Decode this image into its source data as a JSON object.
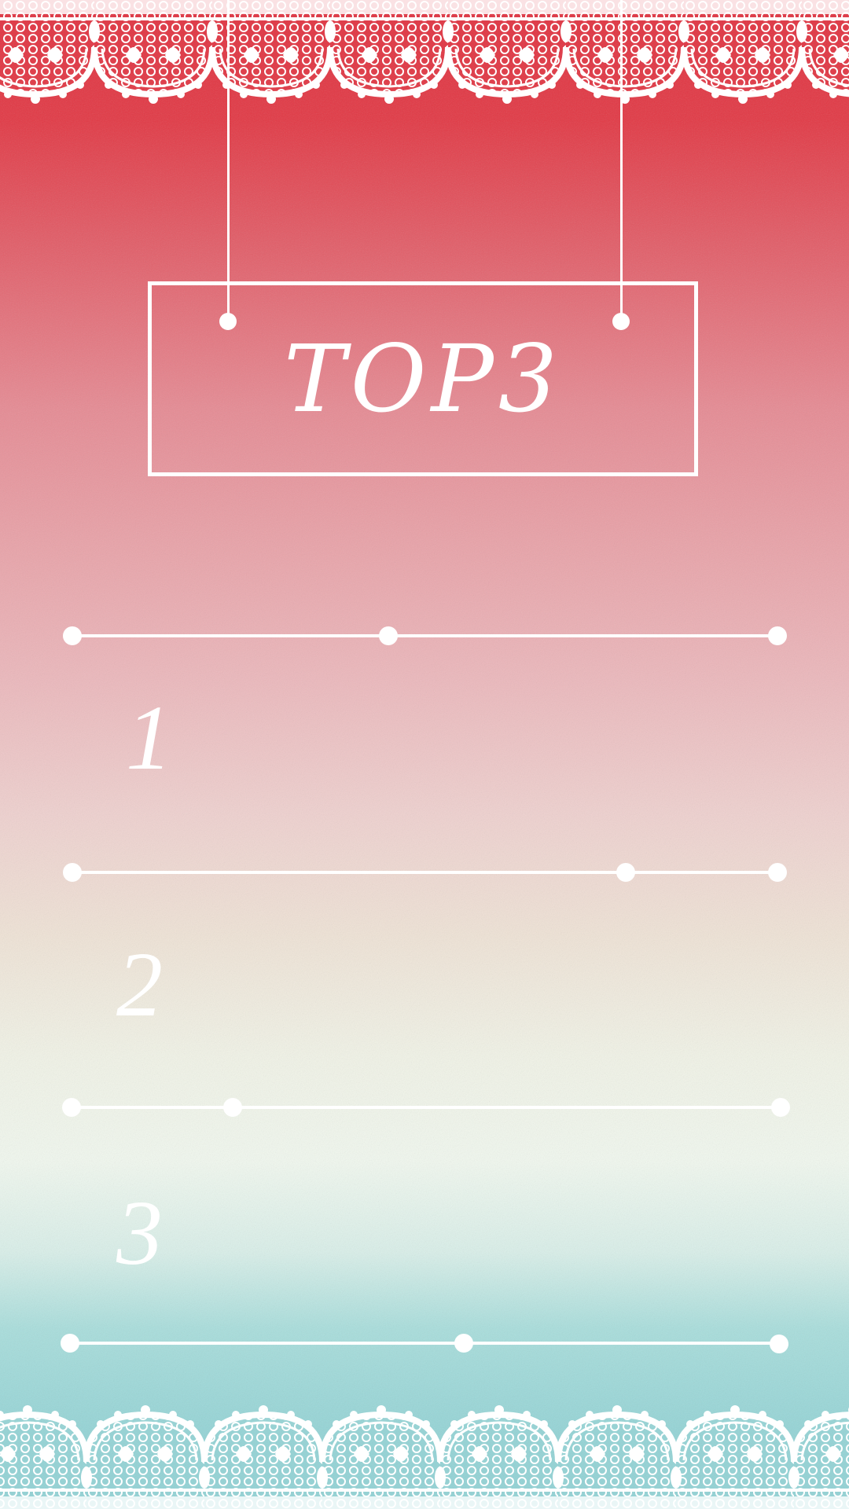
{
  "header": {
    "title": "TOP3"
  },
  "ranks": [
    {
      "number": "1"
    },
    {
      "number": "2"
    },
    {
      "number": "3"
    }
  ],
  "colors": {
    "top": "#e1313f",
    "middle": "#f1f8ef",
    "bottom": "#92d3d6",
    "ink": "#ffffff"
  }
}
